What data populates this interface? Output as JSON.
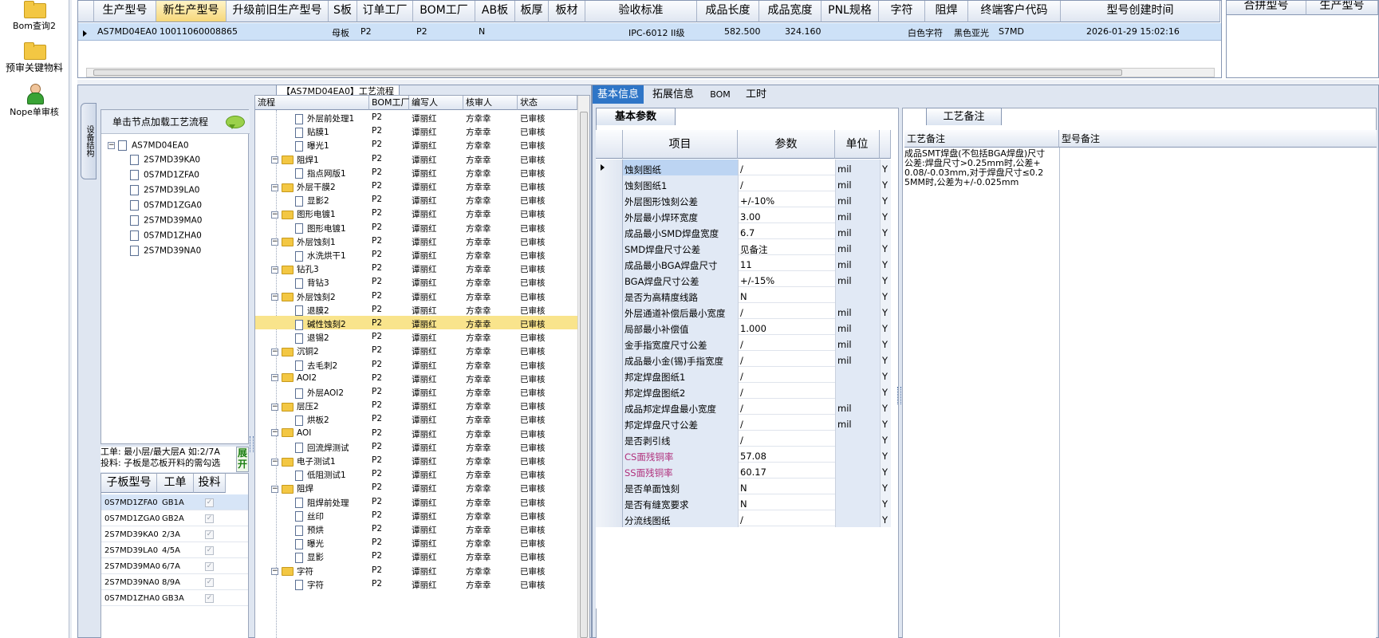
{
  "launcher": {
    "items": [
      {
        "label": "Bom查询2",
        "icon": "folder-icon"
      },
      {
        "label": "预审关键物料",
        "icon": "folder-icon"
      },
      {
        "label": "Nope单审核",
        "icon": "user-icon"
      }
    ]
  },
  "top_grid": {
    "columns": [
      "生产型号",
      "新生产型号",
      "升级前旧生产型号",
      "S板",
      "订单工厂",
      "BOM工厂",
      "AB板",
      "板厚",
      "板材",
      "验收标准",
      "成品长度",
      "成品宽度",
      "PNL规格",
      "字符",
      "阻焊",
      "终端客户代码",
      "型号创建时间"
    ],
    "selected_column": "新生产型号",
    "row": {
      "生产型号": "AS7MD04EA0",
      "新生产型号": "10011060008865",
      "升级前旧生产型号": "",
      "S板": "母板",
      "订单工厂": "P2",
      "BOM工厂": "P2",
      "AB板": "N",
      "板厚": "",
      "板材": "",
      "验收标准": "IPC-6012 II级",
      "成品长度": "582.500",
      "成品宽度": "324.160",
      "PNL规格": "",
      "字符": "白色字符",
      "阻焊": "黑色亚光",
      "终端客户代码": "S7MD",
      "型号创建时间": "2026-01-29 15:02:16"
    }
  },
  "right_grid": {
    "columns": [
      "合拼型号",
      "生产型号"
    ]
  },
  "process_panel": {
    "title": "【AS7MD04EA0】工艺流程",
    "side_tab": "设备结构",
    "tree_hint": "单击节点加载工艺流程",
    "tree": {
      "root": "AS7MD04EA0",
      "children": [
        "2S7MD39KA0",
        "0S7MD1ZFA0",
        "2S7MD39LA0",
        "0S7MD1ZGA0",
        "2S7MD39MA0",
        "0S7MD1ZHA0",
        "2S7MD39NA0"
      ]
    },
    "notes": {
      "line1": "工单: 最小层/最大层A 如:2/7A",
      "line2": "投料: 子板是芯板开料的需勾选"
    },
    "expand_label": "展开",
    "sub_grid": {
      "columns": [
        "子板型号",
        "工单",
        "投料"
      ],
      "rows": [
        {
          "model": "0S7MD1ZFA0",
          "order": "GB1A",
          "feed": true
        },
        {
          "model": "0S7MD1ZGA0",
          "order": "GB2A",
          "feed": true
        },
        {
          "model": "2S7MD39KA0",
          "order": "2/3A",
          "feed": true
        },
        {
          "model": "2S7MD39LA0",
          "order": "4/5A",
          "feed": true
        },
        {
          "model": "2S7MD39MA0",
          "order": "6/7A",
          "feed": true
        },
        {
          "model": "2S7MD39NA0",
          "order": "8/9A",
          "feed": true
        },
        {
          "model": "0S7MD1ZHA0",
          "order": "GB3A",
          "feed": true
        }
      ]
    },
    "flow_grid": {
      "columns": [
        "流程",
        "BOM工厂",
        "编写人",
        "核审人",
        "状态"
      ],
      "rows": [
        {
          "name": "外层前处理1",
          "level": 1,
          "folder": false,
          "bom": "P2",
          "writer": "谭丽红",
          "reviewer": "方幸幸",
          "status": "已审核"
        },
        {
          "name": "贴膜1",
          "level": 1,
          "folder": false,
          "bom": "P2",
          "writer": "谭丽红",
          "reviewer": "方幸幸",
          "status": "已审核"
        },
        {
          "name": "曝光1",
          "level": 1,
          "folder": false,
          "bom": "P2",
          "writer": "谭丽红",
          "reviewer": "方幸幸",
          "status": "已审核"
        },
        {
          "name": "阻焊1",
          "level": 0,
          "folder": true,
          "bom": "P2",
          "writer": "谭丽红",
          "reviewer": "方幸幸",
          "status": "已审核"
        },
        {
          "name": "指点网版1",
          "level": 1,
          "folder": false,
          "bom": "P2",
          "writer": "谭丽红",
          "reviewer": "方幸幸",
          "status": "已审核"
        },
        {
          "name": "外层干膜2",
          "level": 0,
          "folder": true,
          "bom": "P2",
          "writer": "谭丽红",
          "reviewer": "方幸幸",
          "status": "已审核"
        },
        {
          "name": "显影2",
          "level": 1,
          "folder": false,
          "bom": "P2",
          "writer": "谭丽红",
          "reviewer": "方幸幸",
          "status": "已审核"
        },
        {
          "name": "图形电镀1",
          "level": 0,
          "folder": true,
          "bom": "P2",
          "writer": "谭丽红",
          "reviewer": "方幸幸",
          "status": "已审核"
        },
        {
          "name": "图形电镀1",
          "level": 1,
          "folder": false,
          "bom": "P2",
          "writer": "谭丽红",
          "reviewer": "方幸幸",
          "status": "已审核"
        },
        {
          "name": "外层蚀刻1",
          "level": 0,
          "folder": true,
          "bom": "P2",
          "writer": "谭丽红",
          "reviewer": "方幸幸",
          "status": "已审核"
        },
        {
          "name": "水洗烘干1",
          "level": 1,
          "folder": false,
          "bom": "P2",
          "writer": "谭丽红",
          "reviewer": "方幸幸",
          "status": "已审核"
        },
        {
          "name": "钻孔3",
          "level": 0,
          "folder": true,
          "bom": "P2",
          "writer": "谭丽红",
          "reviewer": "方幸幸",
          "status": "已审核"
        },
        {
          "name": "背钻3",
          "level": 1,
          "folder": false,
          "bom": "P2",
          "writer": "谭丽红",
          "reviewer": "方幸幸",
          "status": "已审核"
        },
        {
          "name": "外层蚀刻2",
          "level": 0,
          "folder": true,
          "bom": "P2",
          "writer": "谭丽红",
          "reviewer": "方幸幸",
          "status": "已审核"
        },
        {
          "name": "退膜2",
          "level": 1,
          "folder": false,
          "bom": "P2",
          "writer": "谭丽红",
          "reviewer": "方幸幸",
          "status": "已审核"
        },
        {
          "name": "碱性蚀刻2",
          "level": 1,
          "folder": false,
          "bom": "P2",
          "writer": "谭丽红",
          "reviewer": "方幸幸",
          "status": "已审核",
          "selected": true
        },
        {
          "name": "退锡2",
          "level": 1,
          "folder": false,
          "bom": "P2",
          "writer": "谭丽红",
          "reviewer": "方幸幸",
          "status": "已审核"
        },
        {
          "name": "沉铜2",
          "level": 0,
          "folder": true,
          "bom": "P2",
          "writer": "谭丽红",
          "reviewer": "方幸幸",
          "status": "已审核"
        },
        {
          "name": "去毛刺2",
          "level": 1,
          "folder": false,
          "bom": "P2",
          "writer": "谭丽红",
          "reviewer": "方幸幸",
          "status": "已审核"
        },
        {
          "name": "AOI2",
          "level": 0,
          "folder": true,
          "bom": "P2",
          "writer": "谭丽红",
          "reviewer": "方幸幸",
          "status": "已审核"
        },
        {
          "name": "外层AOI2",
          "level": 1,
          "folder": false,
          "bom": "P2",
          "writer": "谭丽红",
          "reviewer": "方幸幸",
          "status": "已审核"
        },
        {
          "name": "层压2",
          "level": 0,
          "folder": true,
          "bom": "P2",
          "writer": "谭丽红",
          "reviewer": "方幸幸",
          "status": "已审核"
        },
        {
          "name": "烘板2",
          "level": 1,
          "folder": false,
          "bom": "P2",
          "writer": "谭丽红",
          "reviewer": "方幸幸",
          "status": "已审核"
        },
        {
          "name": "AOI",
          "level": 0,
          "folder": true,
          "bom": "P2",
          "writer": "谭丽红",
          "reviewer": "方幸幸",
          "status": "已审核"
        },
        {
          "name": "回流焊测试",
          "level": 1,
          "folder": false,
          "bom": "P2",
          "writer": "谭丽红",
          "reviewer": "方幸幸",
          "status": "已审核"
        },
        {
          "name": "电子测试1",
          "level": 0,
          "folder": true,
          "bom": "P2",
          "writer": "谭丽红",
          "reviewer": "方幸幸",
          "status": "已审核"
        },
        {
          "name": "低阻测试1",
          "level": 1,
          "folder": false,
          "bom": "P2",
          "writer": "谭丽红",
          "reviewer": "方幸幸",
          "status": "已审核"
        },
        {
          "name": "阻焊",
          "level": 0,
          "folder": true,
          "bom": "P2",
          "writer": "谭丽红",
          "reviewer": "方幸幸",
          "status": "已审核"
        },
        {
          "name": "阻焊前处理",
          "level": 1,
          "folder": false,
          "bom": "P2",
          "writer": "谭丽红",
          "reviewer": "方幸幸",
          "status": "已审核"
        },
        {
          "name": "丝印",
          "level": 1,
          "folder": false,
          "bom": "P2",
          "writer": "谭丽红",
          "reviewer": "方幸幸",
          "status": "已审核"
        },
        {
          "name": "预烘",
          "level": 1,
          "folder": false,
          "bom": "P2",
          "writer": "谭丽红",
          "reviewer": "方幸幸",
          "status": "已审核"
        },
        {
          "name": "曝光",
          "level": 1,
          "folder": false,
          "bom": "P2",
          "writer": "谭丽红",
          "reviewer": "方幸幸",
          "status": "已审核"
        },
        {
          "name": "显影",
          "level": 1,
          "folder": false,
          "bom": "P2",
          "writer": "谭丽红",
          "reviewer": "方幸幸",
          "status": "已审核"
        },
        {
          "name": "字符",
          "level": 0,
          "folder": true,
          "bom": "P2",
          "writer": "谭丽红",
          "reviewer": "方幸幸",
          "status": "已审核"
        },
        {
          "name": "字符",
          "level": 1,
          "folder": false,
          "bom": "P2",
          "writer": "谭丽红",
          "reviewer": "方幸幸",
          "status": "已审核"
        }
      ]
    }
  },
  "info_panel": {
    "tabs": [
      "基本信息",
      "拓展信息",
      "BOM",
      "工时"
    ],
    "active_tab": "基本信息",
    "param_section_title": "基本参数",
    "param_grid": {
      "columns": [
        "项目",
        "参数",
        "单位"
      ],
      "rows": [
        {
          "item": "蚀刻图纸",
          "value": "/",
          "unit": "mil",
          "flag": "Y",
          "selected": true
        },
        {
          "item": "蚀刻图纸1",
          "value": "/",
          "unit": "mil",
          "flag": "Y"
        },
        {
          "item": "外层图形蚀刻公差",
          "value": "+/-10%",
          "unit": "mil",
          "flag": "Y"
        },
        {
          "item": "外层最小焊环宽度",
          "value": "3.00",
          "unit": "mil",
          "flag": "Y"
        },
        {
          "item": "成品最小SMD焊盘宽度",
          "value": "6.7",
          "unit": "mil",
          "flag": "Y"
        },
        {
          "item": "SMD焊盘尺寸公差",
          "value": "见备注",
          "unit": "mil",
          "flag": "Y"
        },
        {
          "item": "成品最小BGA焊盘尺寸",
          "value": "11",
          "unit": "mil",
          "flag": "Y"
        },
        {
          "item": "BGA焊盘尺寸公差",
          "value": "+/-15%",
          "unit": "mil",
          "flag": "Y"
        },
        {
          "item": "是否为高精度线路",
          "value": "N",
          "unit": "",
          "flag": "Y"
        },
        {
          "item": "外层通道补偿后最小宽度",
          "value": "/",
          "unit": "mil",
          "flag": "Y"
        },
        {
          "item": "局部最小补偿值",
          "value": "1.000",
          "unit": "mil",
          "flag": "Y"
        },
        {
          "item": "金手指宽度尺寸公差",
          "value": "/",
          "unit": "mil",
          "flag": "Y"
        },
        {
          "item": "成品最小金(锡)手指宽度",
          "value": "/",
          "unit": "mil",
          "flag": "Y"
        },
        {
          "item": "邦定焊盘图纸1",
          "value": "/",
          "unit": "",
          "flag": "Y"
        },
        {
          "item": "邦定焊盘图纸2",
          "value": "/",
          "unit": "",
          "flag": "Y"
        },
        {
          "item": "成品邦定焊盘最小宽度",
          "value": "/",
          "unit": "mil",
          "flag": "Y"
        },
        {
          "item": "邦定焊盘尺寸公差",
          "value": "/",
          "unit": "mil",
          "flag": "Y"
        },
        {
          "item": "是否剥引线",
          "value": "/",
          "unit": "",
          "flag": "Y"
        },
        {
          "item": "CS面残铜率",
          "value": "57.08",
          "unit": "",
          "flag": "Y",
          "highlight": true
        },
        {
          "item": "SS面残铜率",
          "value": "60.17",
          "unit": "",
          "flag": "Y",
          "highlight": true
        },
        {
          "item": "是否单面蚀刻",
          "value": "N",
          "unit": "",
          "flag": "Y"
        },
        {
          "item": "是否有缝宽要求",
          "value": "N",
          "unit": "",
          "flag": "Y"
        },
        {
          "item": "分流线图纸",
          "value": "/",
          "unit": "",
          "flag": "Y"
        }
      ]
    },
    "remarks_section_title": "工艺备注",
    "remarks_columns": [
      "工艺备注",
      "型号备注"
    ],
    "process_remark": "成品SMT焊盘(不包括BGA焊盘)尺寸公差:焊盘尺寸>0.25mm时,公差+0.08/-0.03mm,对于焊盘尺寸≤0.25MM时,公差为+/-0.025mm"
  },
  "colors": {
    "tab_active": "#2e75c7",
    "selected_row": "#cde1f7",
    "highlight_row": "#f9e48c",
    "highlight_text": "#b0307c"
  }
}
